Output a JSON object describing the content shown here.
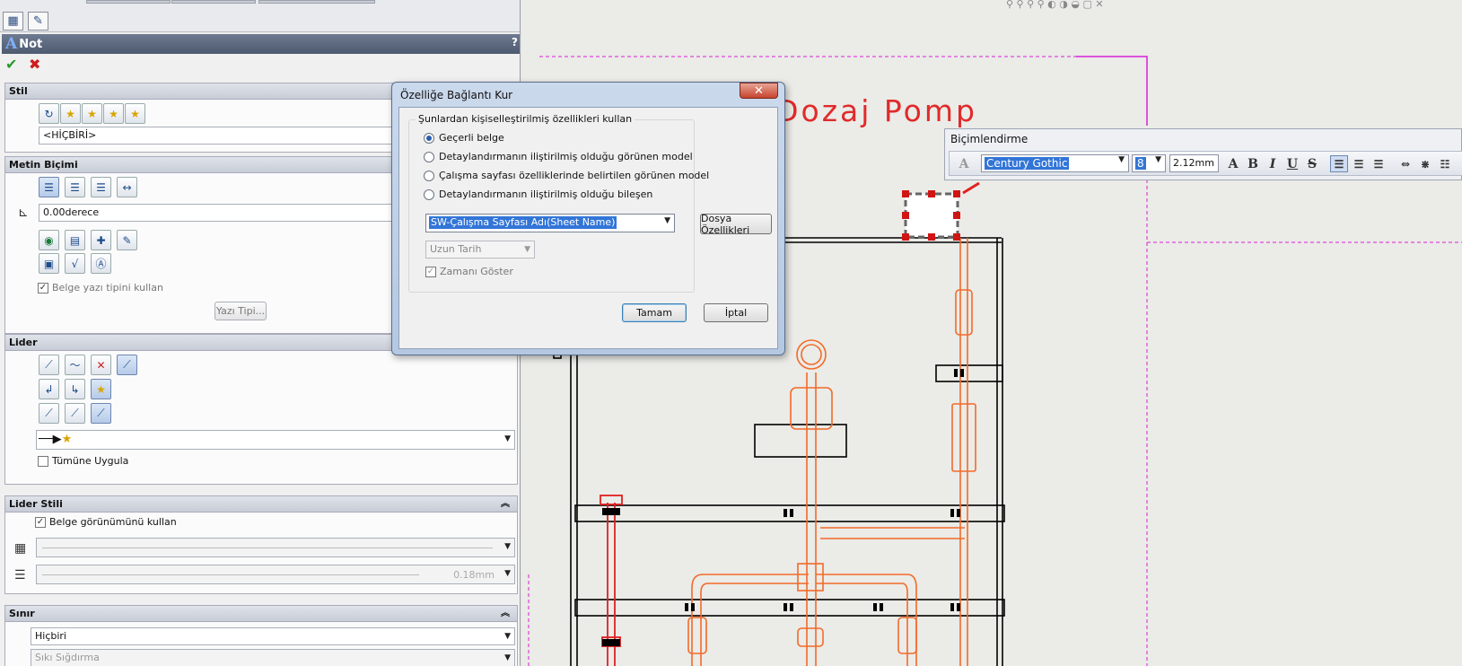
{
  "property_manager": {
    "title": "Not",
    "help": "?",
    "ok_symbol": "✔",
    "cancel_symbol": "✖",
    "stil": {
      "header": "Stil",
      "style_value": "<HİÇBİRİ>"
    },
    "metin_bicimi": {
      "header": "Metin Biçimi",
      "angle_value": "0.00derece",
      "use_doc_font_label": "Belge yazı tipini kullan",
      "font_button": "Yazı Tipi..."
    },
    "lider": {
      "header": "Lider",
      "apply_all_label": "Tümüne Uygula"
    },
    "lider_stili": {
      "header": "Lider Stili",
      "use_doc_display_label": "Belge görünümünü kullan",
      "thickness_value": "0.18mm"
    },
    "sinir": {
      "header": "Sınır",
      "style_value": "Hiçbiri",
      "fit_value": "Sıkı Sığdırma"
    }
  },
  "drawing": {
    "title_text": "Demi NaOCl Dozaj Pomp"
  },
  "formatting_toolbar": {
    "title": "Biçimlendirme",
    "font": "Century Gothic",
    "size": "8",
    "height": "2.12mm",
    "bold": "B",
    "italic": "I",
    "underline": "U",
    "strike": "S"
  },
  "dialog": {
    "title": "Özelliğe Bağlantı Kur",
    "close": "✕",
    "group_label": "Şunlardan kişiselleştirilmiş özellikleri kullan",
    "options": [
      "Geçerli belge",
      "Detaylandırmanın iliştirilmiş olduğu görünen model",
      "Çalışma sayfası özelliklerinde belirtilen görünen model",
      "Detaylandırmanın iliştirilmiş olduğu bileşen"
    ],
    "property_value": "SW-Çalışma Sayfası Adı(Sheet Name)",
    "date_format": "Uzun Tarih",
    "show_time_label": "Zamanı Göster",
    "file_props_button": "Dosya Özellikleri",
    "ok_button": "Tamam",
    "cancel_button": "İptal"
  },
  "colors": {
    "pipe": "#f26b2a",
    "red_pipe": "#e02020",
    "title_text": "#e02a2a",
    "magenta_line": "#d81fd8"
  }
}
